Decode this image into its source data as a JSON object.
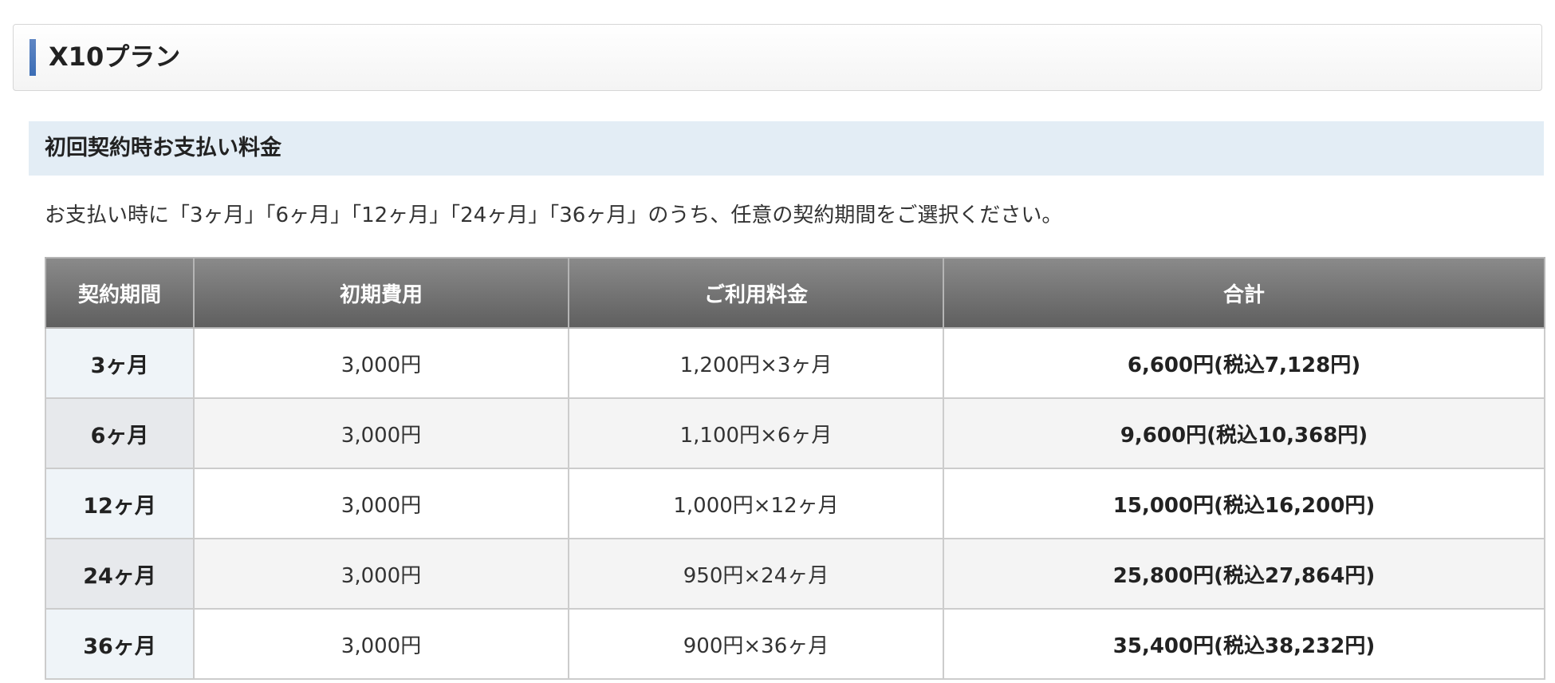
{
  "plan": {
    "title": "X10プラン"
  },
  "section": {
    "title": "初回契約時お支払い料金",
    "description": "お支払い時に「3ヶ月」「6ヶ月」「12ヶ月」「24ヶ月」「36ヶ月」のうち、任意の契約期間をご選択ください。"
  },
  "table": {
    "headers": [
      "契約期間",
      "初期費用",
      "ご利用料金",
      "合計"
    ],
    "rows": [
      {
        "period": "3ヶ月",
        "initial": "3,000円",
        "usage": "1,200円×3ヶ月",
        "total": "6,600円(税込7,128円)"
      },
      {
        "period": "6ヶ月",
        "initial": "3,000円",
        "usage": "1,100円×6ヶ月",
        "total": "9,600円(税込10,368円)"
      },
      {
        "period": "12ヶ月",
        "initial": "3,000円",
        "usage": "1,000円×12ヶ月",
        "total": "15,000円(税込16,200円)"
      },
      {
        "period": "24ヶ月",
        "initial": "3,000円",
        "usage": "950円×24ヶ月",
        "total": "25,800円(税込27,864円)"
      },
      {
        "period": "36ヶ月",
        "initial": "3,000円",
        "usage": "900円×36ヶ月",
        "total": "35,400円(税込38,232円)"
      }
    ]
  },
  "colors": {
    "accent_bar": "#4a78bd",
    "section_background": "#e3edf5",
    "header_background": "#6e6e6e"
  }
}
